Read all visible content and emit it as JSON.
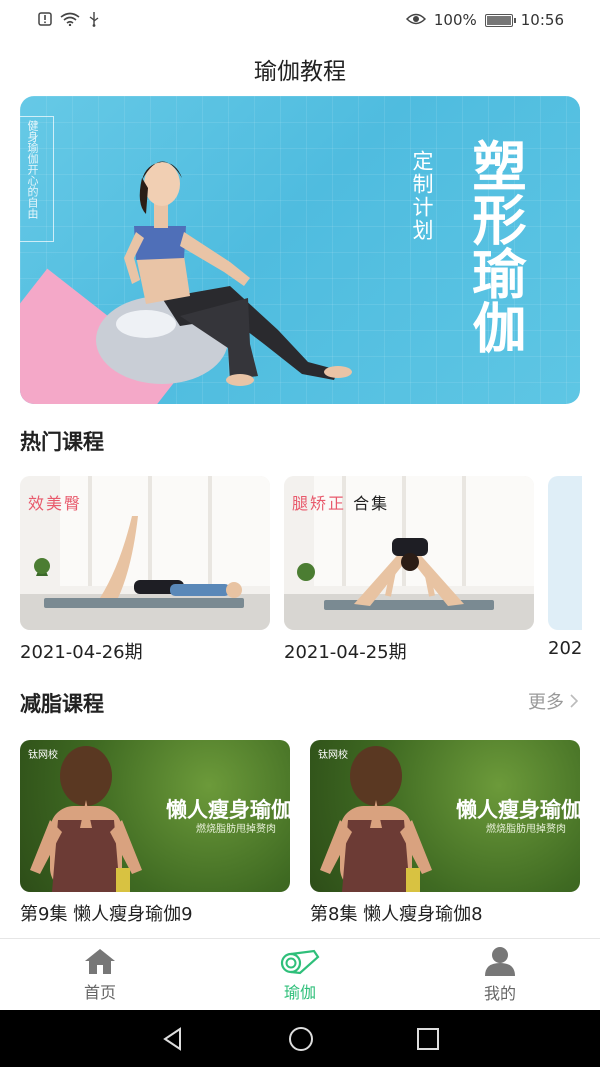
{
  "status_bar": {
    "battery_percent": "100%",
    "battery_level": 1.0,
    "time": "10:56",
    "icons": [
      "alert-icon",
      "wifi-icon",
      "usb-icon",
      "eye-icon",
      "battery-icon"
    ]
  },
  "page": {
    "title": "瑜伽教程"
  },
  "banner": {
    "side_text": "健身瑜伽开心的自由",
    "sub_text": "定制计划",
    "main_text": "塑形瑜伽"
  },
  "hot_courses": {
    "title": "热门课程",
    "items": [
      {
        "tag": "效美臀",
        "label": "2021-04-26期"
      },
      {
        "tag": "腿矫正",
        "tag2": "合集",
        "label": "2021-04-25期"
      },
      {
        "label": "202"
      }
    ]
  },
  "fat_courses": {
    "title": "减脂课程",
    "more": "更多",
    "items": [
      {
        "logo": "钛网校",
        "banner_text": "懒人瘦身瑜伽",
        "banner_sub": "燃烧脂肪甩掉赘肉",
        "label": "第9集 懒人瘦身瑜伽9"
      },
      {
        "logo": "钛网校",
        "banner_text": "懒人瘦身瑜伽",
        "banner_sub": "燃烧脂肪甩掉赘肉",
        "label": "第8集 懒人瘦身瑜伽8"
      }
    ]
  },
  "bottom_nav": {
    "active_color": "#2fbf7a",
    "items": [
      {
        "label": "首页",
        "icon": "home-icon"
      },
      {
        "label": "瑜伽",
        "icon": "yoga-mat-icon"
      },
      {
        "label": "我的",
        "icon": "user-icon"
      }
    ]
  },
  "system_nav": {
    "icons": [
      "back-icon",
      "home-circle-icon",
      "recents-icon"
    ]
  }
}
